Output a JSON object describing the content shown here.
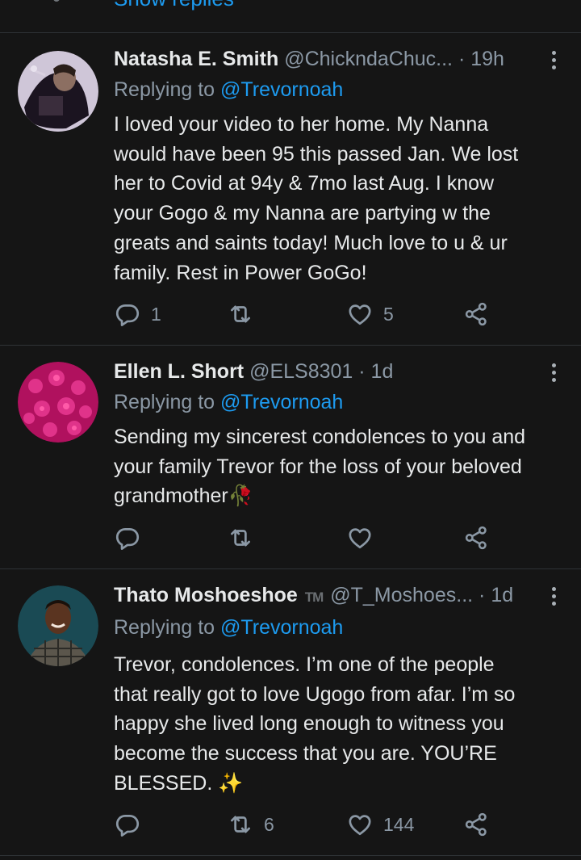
{
  "top": {
    "show_replies": "Show replies"
  },
  "tweets": [
    {
      "name": "Natasha E. Smith",
      "handle": "@ChickndaChuc...",
      "time": "· 19h",
      "replying_prefix": "Replying to",
      "replying_to": "@Trevornoah",
      "text": [
        "I loved your video to her home.  My Nanna",
        "would have been 95 this passed Jan. We lost",
        "her to Covid at 94y & 7mo last Aug. I know",
        "your Gogo & my Nanna are partying w the",
        "greats and saints today! Much love to u & ur",
        "family. Rest in Power GoGo!"
      ],
      "reply_count": "1",
      "retweet_count": "",
      "like_count": "5"
    },
    {
      "name": "Ellen L. Short",
      "handle": "@ELS8301",
      "time": "· 1d",
      "replying_prefix": "Replying to",
      "replying_to": "@Trevornoah",
      "text": [
        "Sending my sincerest condolences to you and",
        "your family Trevor for the loss of your beloved",
        "grandmother🥀"
      ],
      "reply_count": "",
      "retweet_count": "",
      "like_count": ""
    },
    {
      "name": "Thato Moshoeshoe",
      "badge": "TM",
      "handle": "@T_Moshoes...",
      "time": "· 1d",
      "replying_prefix": "Replying to",
      "replying_to": "@Trevornoah",
      "text": [
        "Trevor, condolences. I’m one of the people",
        "that really got to love Ugogo from afar. I’m so",
        "happy she lived long enough to witness you",
        "become the success that you are. YOU’RE",
        "BLESSED. ✨"
      ],
      "reply_count": "",
      "retweet_count": "6",
      "like_count": "144"
    }
  ],
  "icons": {
    "reply": "reply-icon",
    "retweet": "retweet-icon",
    "like": "heart-icon",
    "share": "share-icon",
    "more": "more-options-icon"
  },
  "colors": {
    "background": "#151515",
    "link": "#1d9bf0",
    "muted": "#8b98a5"
  }
}
